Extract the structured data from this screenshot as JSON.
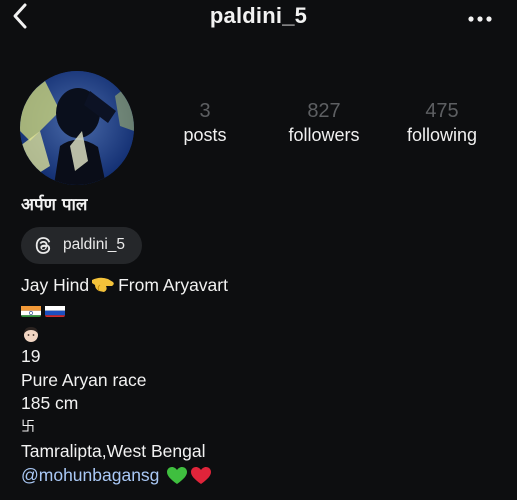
{
  "header": {
    "username": "paldini_5",
    "back_icon": "chevron-left-icon",
    "more_icon": "more-horizontal-icon"
  },
  "profile": {
    "avatar_icon": "profile-photo",
    "full_name": "अर्पण पाल",
    "stats": [
      {
        "count": "3",
        "label": "posts"
      },
      {
        "count": "827",
        "label": "followers"
      },
      {
        "count": "475",
        "label": "following"
      }
    ],
    "threads_badge": {
      "icon": "threads-icon",
      "label": "paldini_5"
    }
  },
  "bio": {
    "line1_prefix": "Jay Hind",
    "line1_suffix": "From Aryavart",
    "line2_flags": [
      "india-flag-icon",
      "russia-flag-icon"
    ],
    "line3_emoji": "person-face-icon",
    "line4": "19",
    "line5": "Pure Aryan race",
    "line6": "185 cm",
    "line7": "卐",
    "line8": "Tamralipta,West Bengal",
    "mention": "@mohunbagansg",
    "heart_colors": {
      "green": "#3fbf3f",
      "red": "#e0243a"
    }
  },
  "colors": {
    "background": "#0d0e10",
    "text": "#f2f2f2",
    "muted_count": "#5d5f62",
    "link": "#a9c8f5",
    "chip": "#25272a"
  }
}
